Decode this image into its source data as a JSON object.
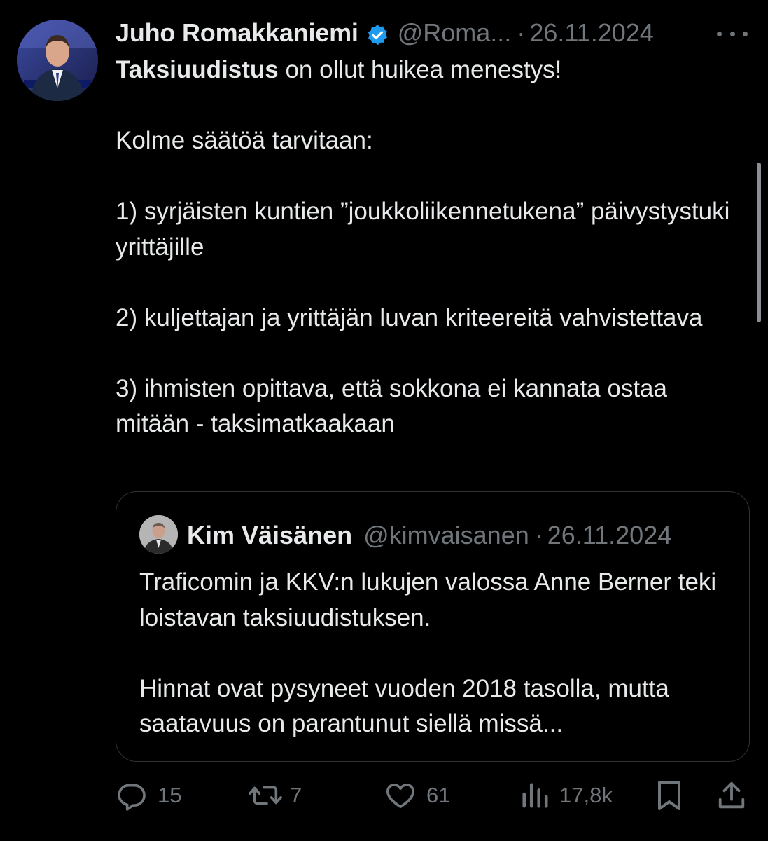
{
  "tweet": {
    "author": {
      "name": "Juho Romakkaniemi",
      "handle": "@Roma...",
      "verified": true,
      "avatar": "person-avatar"
    },
    "separator": "·",
    "date": "26.11.2024",
    "more_icon": "more-dots-icon",
    "text": {
      "intro_bold": "Taksiuudistus",
      "intro_rest": " on ollut huikea menestys!",
      "lead": "Kolme säätöä tarvitaan:",
      "point1": "1) syrjäisten kuntien ”joukkoliikennetukena” päivystystuki yrittäjille",
      "point2": "2) kuljettajan ja yrittäjän luvan kriteereitä vahvistettava",
      "point3": "3) ihmisten opittava, että sokkona ei kannata ostaa mitään - taksimatkaakaan"
    },
    "quote": {
      "name": "Kim Väisänen",
      "handle": "@kimvaisanen",
      "separator": "·",
      "date": "26.11.2024",
      "avatar": "person-avatar",
      "paragraph1": "Traficomin ja KKV:n lukujen valossa Anne Berner teki loistavan taksiuudistuksen.",
      "paragraph2": "Hinnat ovat pysyneet vuoden 2018 tasolla, mutta saatavuus on parantunut siellä missä..."
    },
    "actions": {
      "replies": {
        "icon": "reply-icon",
        "count": "15"
      },
      "reposts": {
        "icon": "repost-icon",
        "count": "7"
      },
      "likes": {
        "icon": "heart-icon",
        "count": "61"
      },
      "views": {
        "icon": "views-icon",
        "count": "17,8k"
      },
      "bookmark": {
        "icon": "bookmark-icon"
      },
      "share": {
        "icon": "share-icon"
      }
    }
  },
  "colors": {
    "background": "#000000",
    "text": "#e7e9ea",
    "muted": "#71767b",
    "border": "#2f3336",
    "verified": "#1d9bf0"
  }
}
